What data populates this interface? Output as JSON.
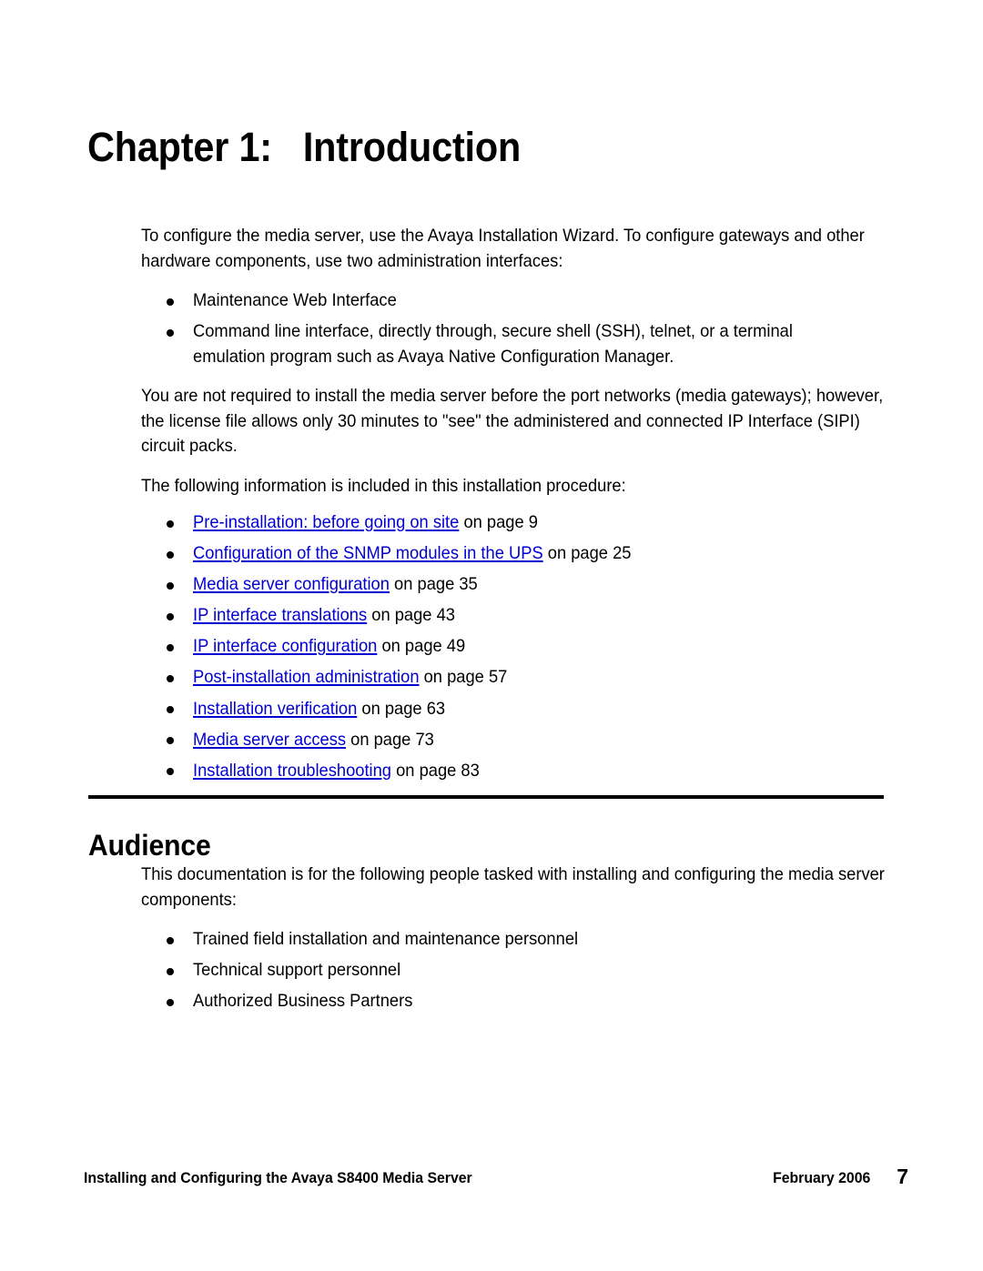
{
  "chapter": {
    "heading": "Chapter 1:   Introduction"
  },
  "intro": {
    "paragraph_1": "To configure the media server, use the Avaya Installation Wizard. To configure gateways and other hardware components, use two administration interfaces:",
    "interfaces": [
      "Maintenance Web Interface",
      "Command line interface, directly through, secure shell (SSH), telnet, or a terminal emulation program such as Avaya Native Configuration Manager."
    ],
    "paragraph_2": "You are not required to install the media server before the port networks (media gateways); however, the license file allows only 30 minutes to \"see\" the administered and connected IP Interface (SIPI) circuit packs.",
    "paragraph_3": "The following information is included in this installation procedure:",
    "link_color": "#0000d2",
    "cross_references": [
      {
        "link": "Pre-installation: before going on site",
        "pageref": " on page 9"
      },
      {
        "link": "Configuration of the SNMP modules in the UPS",
        "pageref": " on page 25"
      },
      {
        "link": "Media server configuration",
        "pageref": " on page 35"
      },
      {
        "link": "IP interface translations",
        "pageref": " on page 43"
      },
      {
        "link": "IP interface configuration",
        "pageref": " on page 49"
      },
      {
        "link": "Post-installation administration",
        "pageref": " on page 57"
      },
      {
        "link": "Installation verification",
        "pageref": " on page 63"
      },
      {
        "link": "Media server access",
        "pageref": " on page 73"
      },
      {
        "link": "Installation troubleshooting",
        "pageref": " on page 83"
      }
    ]
  },
  "audience": {
    "heading": "Audience",
    "paragraph_1": "This documentation is for the following people tasked with installing and configuring the media server components:",
    "roles": [
      "Trained field installation and maintenance personnel",
      "Technical support personnel",
      "Authorized Business Partners"
    ]
  },
  "footer": {
    "document_title": "Installing and Configuring the Avaya S8400 Media Server",
    "date": "February 2006",
    "page_number": "7"
  }
}
